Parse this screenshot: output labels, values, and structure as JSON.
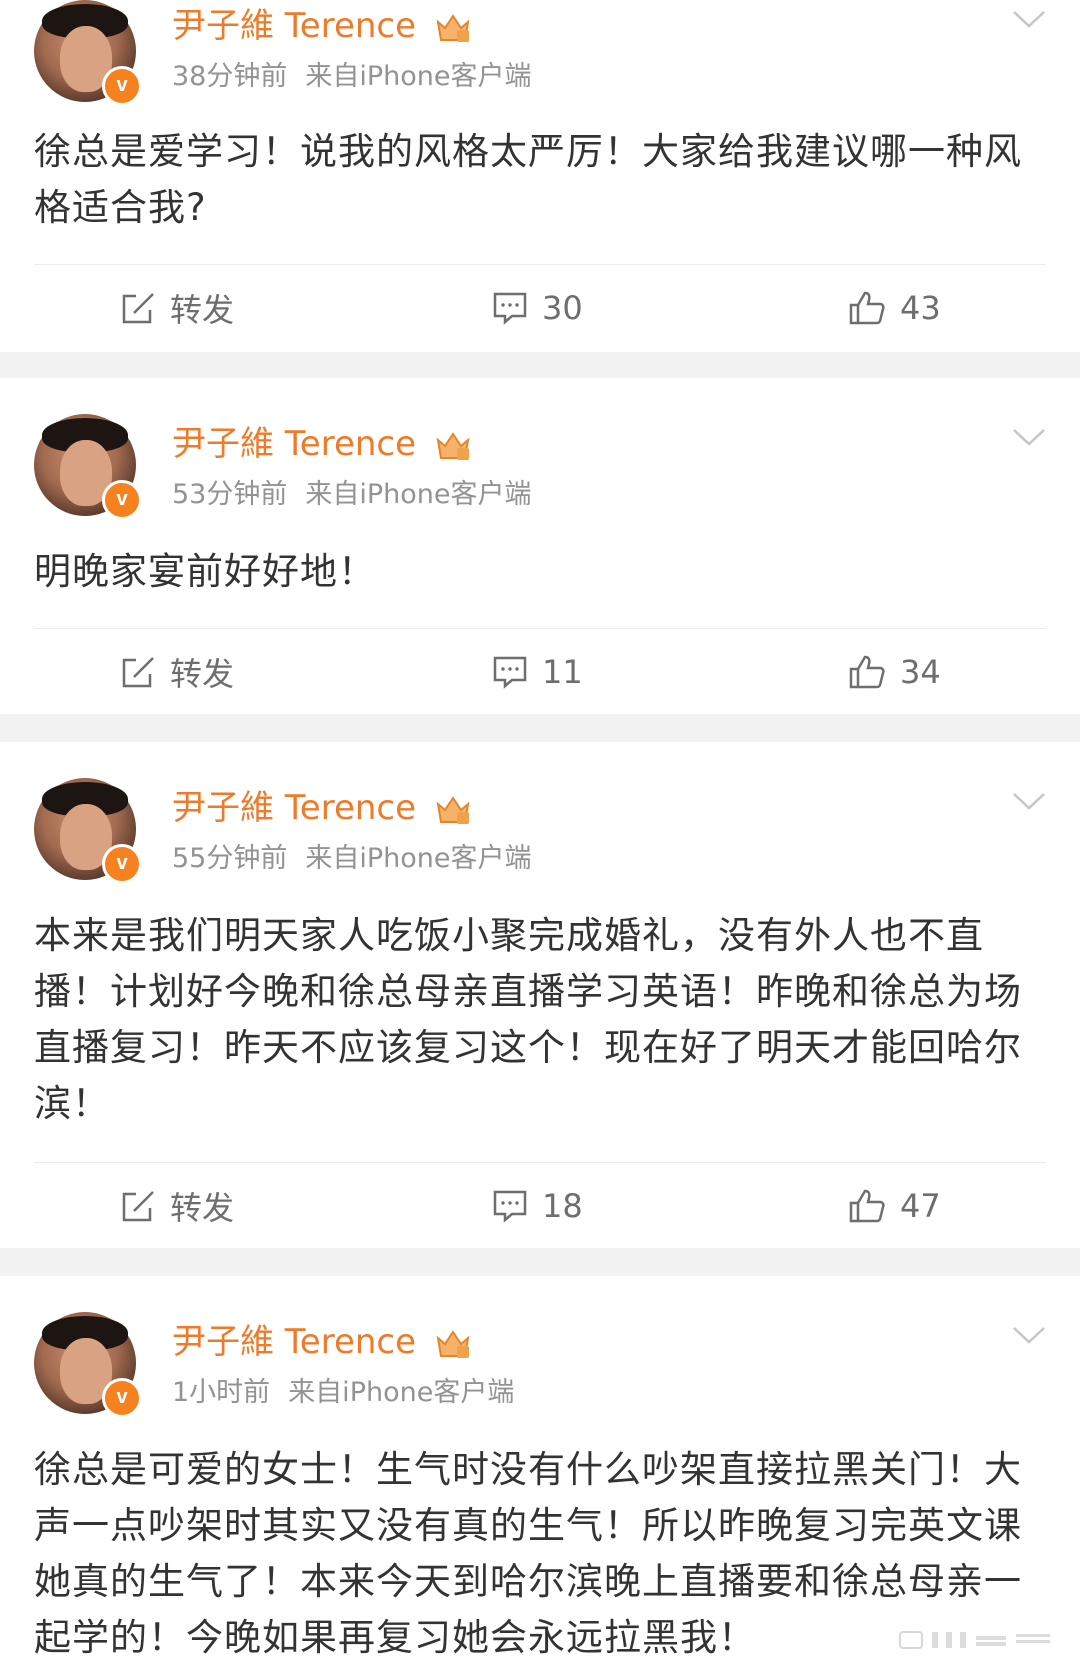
{
  "colors": {
    "name": "#ee7b2a",
    "meta": "#939393",
    "text": "#333333",
    "badge": "#f5821f",
    "separator": "#f2f2f2"
  },
  "posts": [
    {
      "author": "尹子維 Terence",
      "time": "38分钟前",
      "source": "来自iPhone客户端",
      "text": "徐总是爱学习！说我的风格太严厉！大家给我建议哪一种风格适合我?",
      "repost_label": "转发",
      "comments": "30",
      "likes": "43"
    },
    {
      "author": "尹子維 Terence",
      "time": "53分钟前",
      "source": "来自iPhone客户端",
      "text": "明晚家宴前好好地！",
      "repost_label": "转发",
      "comments": "11",
      "likes": "34"
    },
    {
      "author": "尹子維 Terence",
      "time": "55分钟前",
      "source": "来自iPhone客户端",
      "text": "本来是我们明天家人吃饭小聚完成婚礼，没有外人也不直播！计划好今晚和徐总母亲直播学习英语！昨晚和徐总为场直播复习！昨天不应该复习这个！现在好了明天才能回哈尔滨！",
      "repost_label": "转发",
      "comments": "18",
      "likes": "47"
    },
    {
      "author": "尹子維 Terence",
      "time": "1小时前",
      "source": "来自iPhone客户端",
      "text": "徐总是可爱的女士！生气时没有什么吵架直接拉黑关门！大声一点吵架时其实又没有真的生气！所以昨晚复习完英文课她真的生气了！本来今天到哈尔滨晚上直播要和徐总母亲一起学的！今晚如果再复习她会永远拉黑我！"
    }
  ]
}
